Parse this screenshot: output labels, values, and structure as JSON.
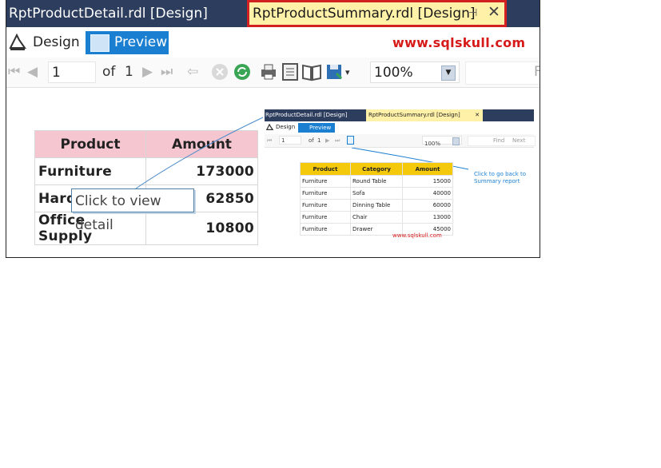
{
  "tabs": {
    "inactive": "RptProductDetail.rdl [Design]",
    "active": "RptProductSummary.rdl [Design]",
    "pin_icon": "pin-icon",
    "close_icon": "close-icon"
  },
  "mode": {
    "design_label": "Design",
    "preview_label": "Preview",
    "watermark": "www.sqlskull.com"
  },
  "toolbar": {
    "page_value": "1",
    "of_label": "of",
    "total_pages": "1",
    "zoom_value": "100%",
    "find_label": "F"
  },
  "report": {
    "headers": [
      "Product",
      "Amount"
    ],
    "rows": [
      {
        "product": "Furniture",
        "amount": "173000"
      },
      {
        "product": "Hard",
        "amount": "62850"
      },
      {
        "product": "Office Supply",
        "amount": "10800"
      }
    ],
    "tooltip": "Click to view detail",
    "header_color": "#f6c6d0"
  },
  "inset": {
    "tab_inactive": "RptProductDetail.rdl [Design]",
    "tab_active": "RptProductSummary.rdl [Design]",
    "design_label": "Design",
    "preview_label": "Preview",
    "page_value": "1",
    "of_label": "of",
    "total_pages": "1",
    "zoom_value": "100%",
    "find_label": "Find",
    "next_label": "Next",
    "headers": [
      "Product",
      "Category",
      "Amount"
    ],
    "rows": [
      {
        "product": "Furniture",
        "category": "Round Table",
        "amount": "15000"
      },
      {
        "product": "Furniture",
        "category": "Sofa",
        "amount": "40000"
      },
      {
        "product": "Furniture",
        "category": "Dinning Table",
        "amount": "60000"
      },
      {
        "product": "Furniture",
        "category": "Chair",
        "amount": "13000"
      },
      {
        "product": "Furniture",
        "category": "Drawer",
        "amount": "45000"
      }
    ],
    "watermark": "www.sqlskull.com",
    "note": "Click to go back to Summary report",
    "header_color": "#f4c80b"
  }
}
